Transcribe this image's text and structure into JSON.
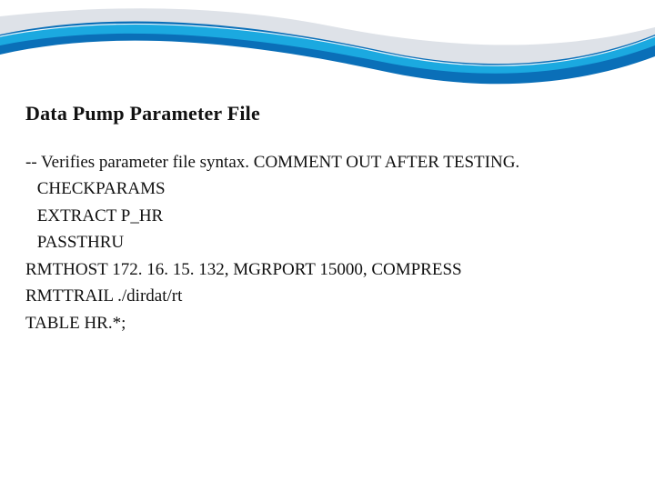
{
  "slide": {
    "title": "Data Pump Parameter File",
    "lines": [
      "-- Verifies parameter file syntax. COMMENT OUT AFTER TESTING.",
      " CHECKPARAMS",
      " EXTRACT P_HR",
      " PASSTHRU",
      "RMTHOST 172. 16. 15. 132, MGRPORT 15000, COMPRESS",
      "RMTTRAIL ./dirdat/rt",
      "TABLE HR.*;"
    ]
  }
}
